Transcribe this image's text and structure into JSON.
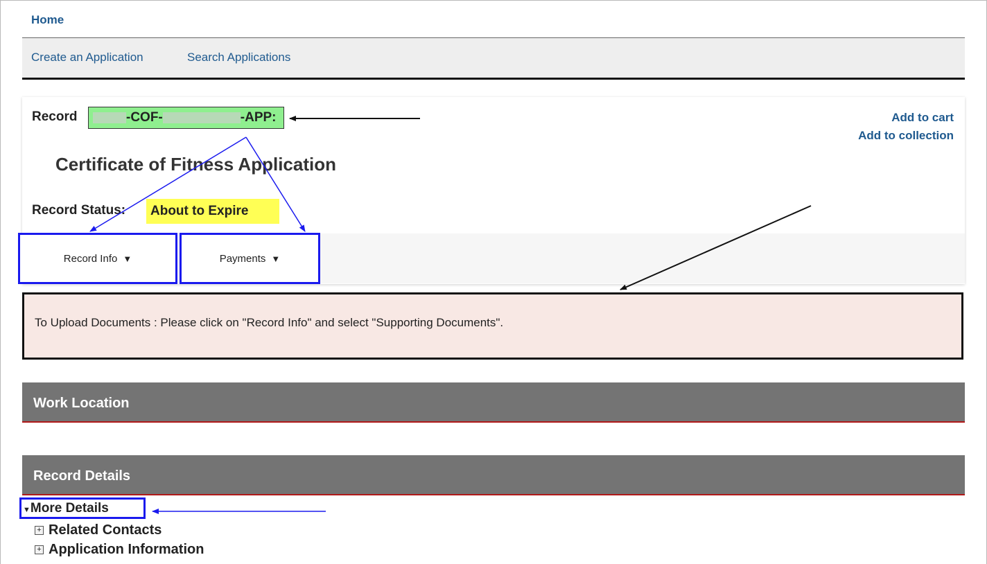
{
  "nav": {
    "home_label": "Home",
    "create_label": "Create an Application",
    "search_label": "Search Applications"
  },
  "record": {
    "label": "Record",
    "id_part1": "-COF-",
    "id_part2": "-APP:",
    "title": "Certificate of Fitness Application",
    "status_label": "Record Status:",
    "status_value": "About to Expire"
  },
  "actions": {
    "add_to_cart": "Add to cart",
    "add_to_collection": "Add to collection"
  },
  "tabs": [
    {
      "label": "Record Info"
    },
    {
      "label": "Payments"
    }
  ],
  "notice": {
    "text": "To Upload Documents : Please click on \"Record Info\" and select \"Supporting Documents\"."
  },
  "sections": {
    "work_location": "Work Location",
    "record_details": "Record Details"
  },
  "details": {
    "more_details": "More Details",
    "related_contacts": "Related Contacts",
    "application_information": "Application Information"
  },
  "colors": {
    "link": "#1f5a8f",
    "highlight_green": "#8fef8f",
    "highlight_yellow": "#ffff55",
    "annotation_blue": "#1a1aee",
    "section_bar": "#747474",
    "section_underline": "#b01818",
    "notice_bg": "#f8e8e4"
  }
}
